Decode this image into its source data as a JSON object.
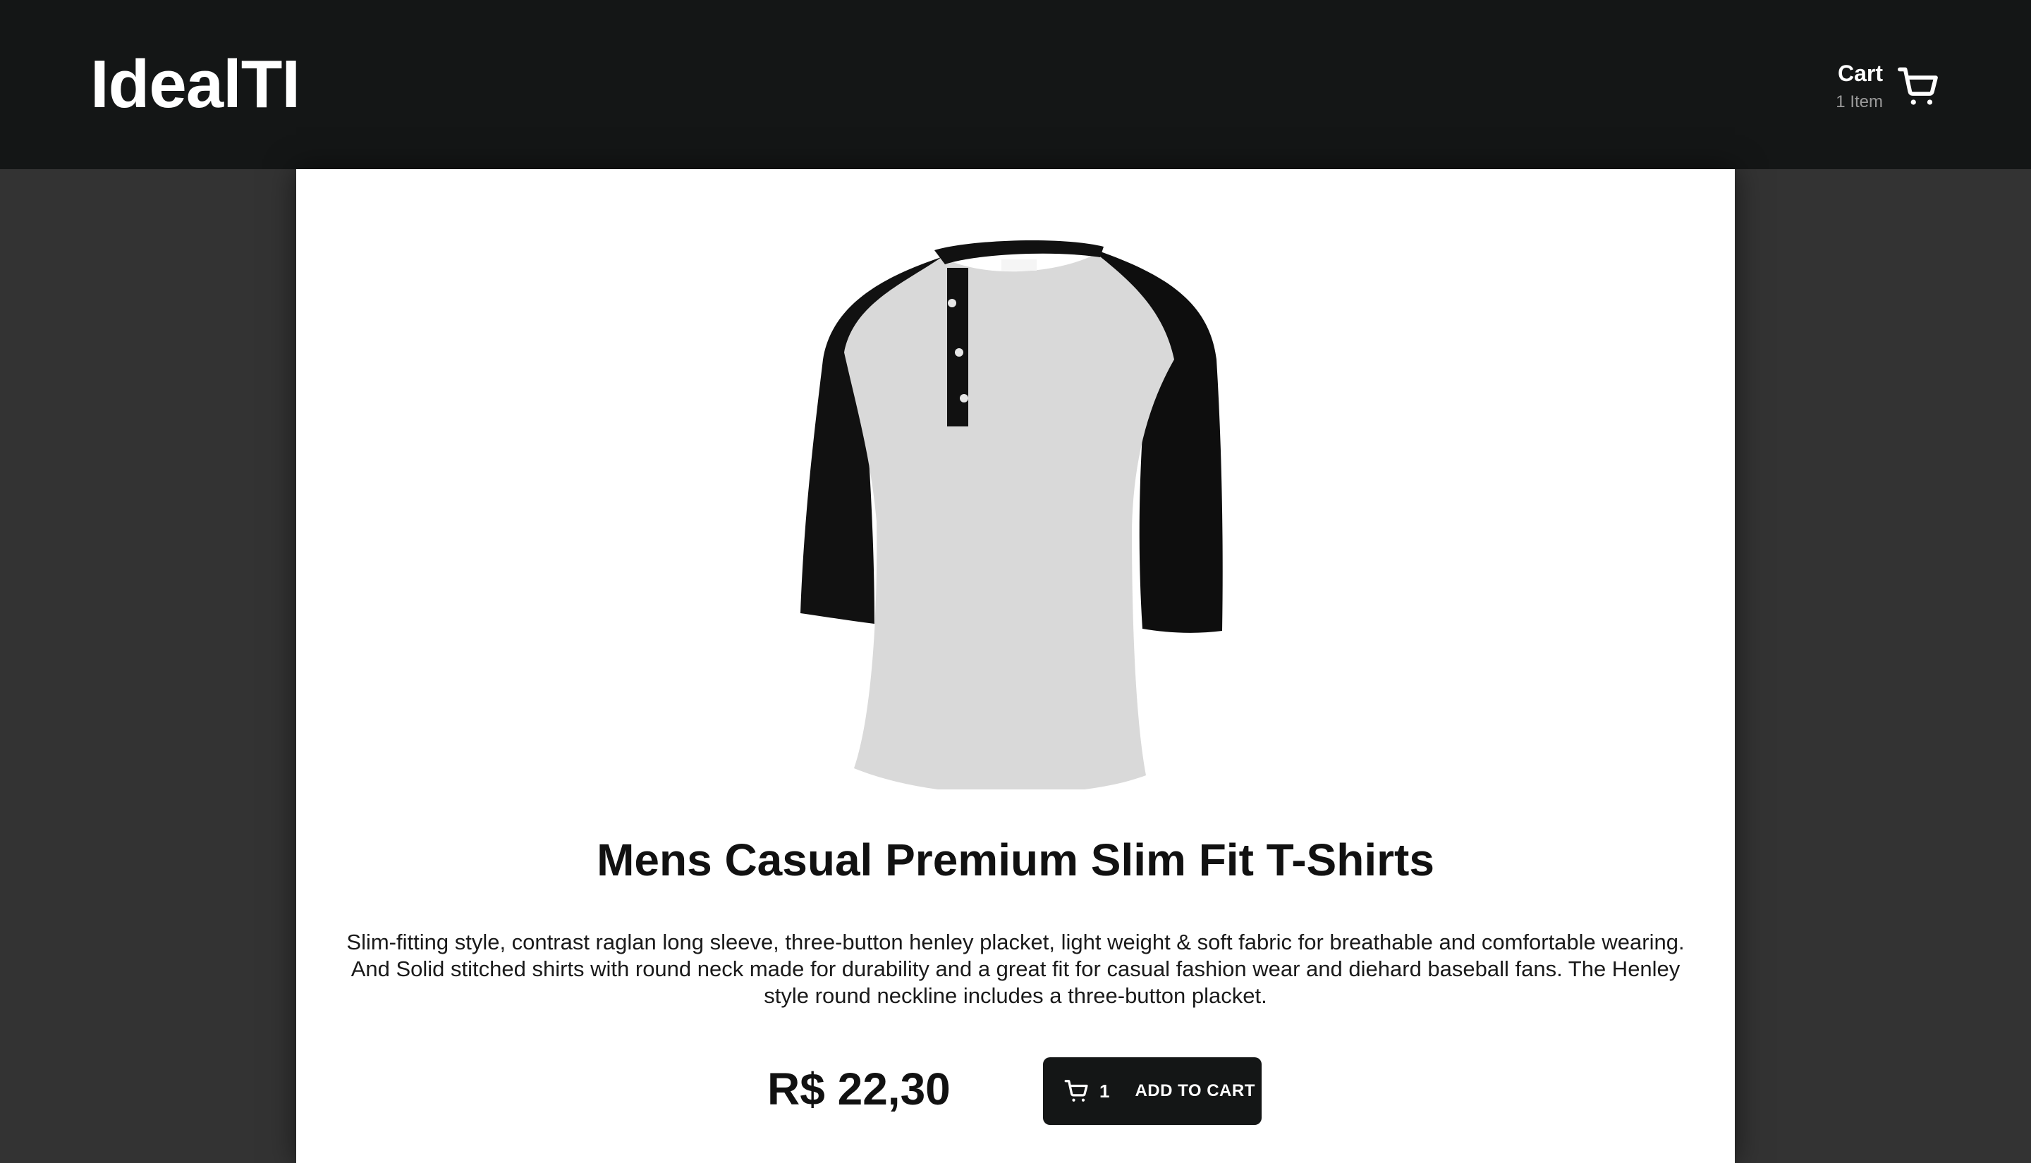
{
  "header": {
    "logo": "IdealTI",
    "cart": {
      "title": "Cart",
      "count": "1 Item",
      "icon": "shopping-cart-icon"
    }
  },
  "product": {
    "image_alt": "Mens Casual Premium Slim Fit T-Shirts",
    "title": "Mens Casual Premium Slim Fit T-Shirts",
    "description": "Slim-fitting style, contrast raglan long sleeve, three-button henley placket, light weight & soft fabric for breathable and comfortable wearing. And Solid stitched shirts with round neck made for durability and a great fit for casual fashion wear and diehard baseball fans. The Henley style round neckline includes a three-button placket.",
    "price": "R$ 22,30",
    "add_to_cart": {
      "quantity": "1",
      "label": "ADD TO CART",
      "icon": "shopping-cart-icon"
    }
  },
  "colors": {
    "header_bg": "#141616",
    "page_bg": "#333333",
    "card_bg": "#ffffff",
    "button_bg": "#141616"
  }
}
